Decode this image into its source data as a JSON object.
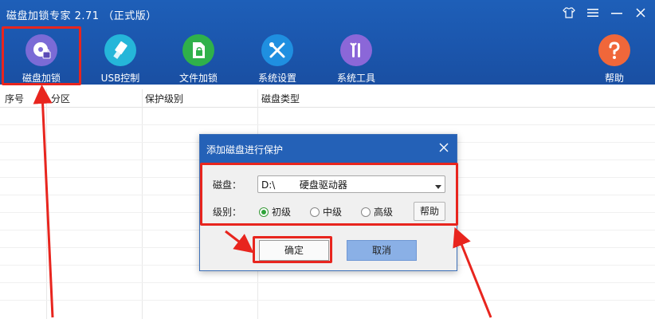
{
  "window": {
    "title": "磁盘加锁专家 2.71 （正式版）",
    "controls": [
      "shirt-icon",
      "menu-icon",
      "minimize-icon",
      "close-icon"
    ]
  },
  "toolbar": {
    "items": [
      {
        "label": "磁盘加锁",
        "icon": "disk-lock-icon",
        "color": "#7b6bd6"
      },
      {
        "label": "USB控制",
        "icon": "usb-icon",
        "color": "#25b6d9"
      },
      {
        "label": "文件加锁",
        "icon": "file-lock-icon",
        "color": "#2fb14a"
      },
      {
        "label": "系统设置",
        "icon": "tools-icon",
        "color": "#1f8fe0"
      },
      {
        "label": "系统工具",
        "icon": "wrench-icon",
        "color": "#8b67d8"
      },
      {
        "label": "帮助",
        "icon": "help-icon",
        "color": "#f0673a"
      }
    ]
  },
  "table": {
    "columns": [
      "序号",
      "分区",
      "保护级别",
      "磁盘类型"
    ]
  },
  "dialog": {
    "title": "添加磁盘进行保护",
    "disk_label": "磁盘：",
    "disk_value": "D:\\        硬盘驱动器",
    "level_label": "级别：",
    "levels": [
      {
        "label": "初级",
        "selected": true
      },
      {
        "label": "中级",
        "selected": false
      },
      {
        "label": "高级",
        "selected": false
      }
    ],
    "help_label": "帮助",
    "ok_label": "确定",
    "cancel_label": "取消"
  },
  "colors": {
    "header_blue": "#1b56ad",
    "dialog_title": "#2461b7",
    "highlight_red": "#e8251e",
    "radio_green": "#2fa33a"
  }
}
